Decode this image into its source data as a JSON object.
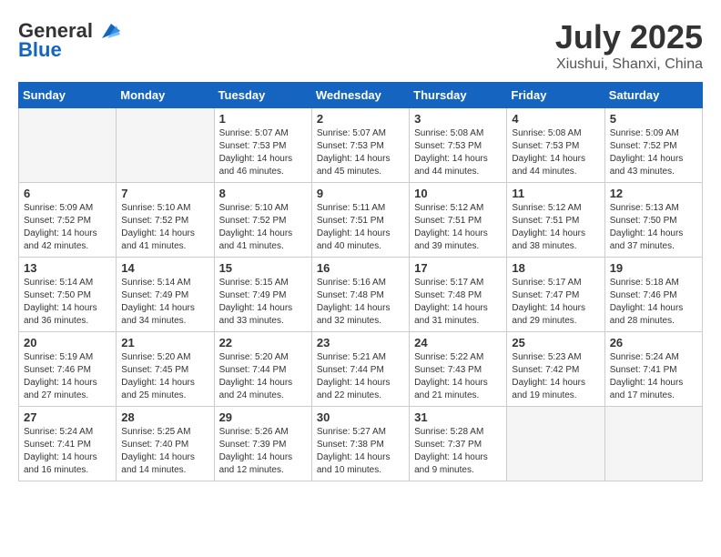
{
  "header": {
    "logo_general": "General",
    "logo_blue": "Blue",
    "title": "July 2025",
    "subtitle": "Xiushui, Shanxi, China"
  },
  "weekdays": [
    "Sunday",
    "Monday",
    "Tuesday",
    "Wednesday",
    "Thursday",
    "Friday",
    "Saturday"
  ],
  "weeks": [
    [
      {
        "day": "",
        "info": ""
      },
      {
        "day": "",
        "info": ""
      },
      {
        "day": "1",
        "info": "Sunrise: 5:07 AM\nSunset: 7:53 PM\nDaylight: 14 hours and 46 minutes."
      },
      {
        "day": "2",
        "info": "Sunrise: 5:07 AM\nSunset: 7:53 PM\nDaylight: 14 hours and 45 minutes."
      },
      {
        "day": "3",
        "info": "Sunrise: 5:08 AM\nSunset: 7:53 PM\nDaylight: 14 hours and 44 minutes."
      },
      {
        "day": "4",
        "info": "Sunrise: 5:08 AM\nSunset: 7:53 PM\nDaylight: 14 hours and 44 minutes."
      },
      {
        "day": "5",
        "info": "Sunrise: 5:09 AM\nSunset: 7:52 PM\nDaylight: 14 hours and 43 minutes."
      }
    ],
    [
      {
        "day": "6",
        "info": "Sunrise: 5:09 AM\nSunset: 7:52 PM\nDaylight: 14 hours and 42 minutes."
      },
      {
        "day": "7",
        "info": "Sunrise: 5:10 AM\nSunset: 7:52 PM\nDaylight: 14 hours and 41 minutes."
      },
      {
        "day": "8",
        "info": "Sunrise: 5:10 AM\nSunset: 7:52 PM\nDaylight: 14 hours and 41 minutes."
      },
      {
        "day": "9",
        "info": "Sunrise: 5:11 AM\nSunset: 7:51 PM\nDaylight: 14 hours and 40 minutes."
      },
      {
        "day": "10",
        "info": "Sunrise: 5:12 AM\nSunset: 7:51 PM\nDaylight: 14 hours and 39 minutes."
      },
      {
        "day": "11",
        "info": "Sunrise: 5:12 AM\nSunset: 7:51 PM\nDaylight: 14 hours and 38 minutes."
      },
      {
        "day": "12",
        "info": "Sunrise: 5:13 AM\nSunset: 7:50 PM\nDaylight: 14 hours and 37 minutes."
      }
    ],
    [
      {
        "day": "13",
        "info": "Sunrise: 5:14 AM\nSunset: 7:50 PM\nDaylight: 14 hours and 36 minutes."
      },
      {
        "day": "14",
        "info": "Sunrise: 5:14 AM\nSunset: 7:49 PM\nDaylight: 14 hours and 34 minutes."
      },
      {
        "day": "15",
        "info": "Sunrise: 5:15 AM\nSunset: 7:49 PM\nDaylight: 14 hours and 33 minutes."
      },
      {
        "day": "16",
        "info": "Sunrise: 5:16 AM\nSunset: 7:48 PM\nDaylight: 14 hours and 32 minutes."
      },
      {
        "day": "17",
        "info": "Sunrise: 5:17 AM\nSunset: 7:48 PM\nDaylight: 14 hours and 31 minutes."
      },
      {
        "day": "18",
        "info": "Sunrise: 5:17 AM\nSunset: 7:47 PM\nDaylight: 14 hours and 29 minutes."
      },
      {
        "day": "19",
        "info": "Sunrise: 5:18 AM\nSunset: 7:46 PM\nDaylight: 14 hours and 28 minutes."
      }
    ],
    [
      {
        "day": "20",
        "info": "Sunrise: 5:19 AM\nSunset: 7:46 PM\nDaylight: 14 hours and 27 minutes."
      },
      {
        "day": "21",
        "info": "Sunrise: 5:20 AM\nSunset: 7:45 PM\nDaylight: 14 hours and 25 minutes."
      },
      {
        "day": "22",
        "info": "Sunrise: 5:20 AM\nSunset: 7:44 PM\nDaylight: 14 hours and 24 minutes."
      },
      {
        "day": "23",
        "info": "Sunrise: 5:21 AM\nSunset: 7:44 PM\nDaylight: 14 hours and 22 minutes."
      },
      {
        "day": "24",
        "info": "Sunrise: 5:22 AM\nSunset: 7:43 PM\nDaylight: 14 hours and 21 minutes."
      },
      {
        "day": "25",
        "info": "Sunrise: 5:23 AM\nSunset: 7:42 PM\nDaylight: 14 hours and 19 minutes."
      },
      {
        "day": "26",
        "info": "Sunrise: 5:24 AM\nSunset: 7:41 PM\nDaylight: 14 hours and 17 minutes."
      }
    ],
    [
      {
        "day": "27",
        "info": "Sunrise: 5:24 AM\nSunset: 7:41 PM\nDaylight: 14 hours and 16 minutes."
      },
      {
        "day": "28",
        "info": "Sunrise: 5:25 AM\nSunset: 7:40 PM\nDaylight: 14 hours and 14 minutes."
      },
      {
        "day": "29",
        "info": "Sunrise: 5:26 AM\nSunset: 7:39 PM\nDaylight: 14 hours and 12 minutes."
      },
      {
        "day": "30",
        "info": "Sunrise: 5:27 AM\nSunset: 7:38 PM\nDaylight: 14 hours and 10 minutes."
      },
      {
        "day": "31",
        "info": "Sunrise: 5:28 AM\nSunset: 7:37 PM\nDaylight: 14 hours and 9 minutes."
      },
      {
        "day": "",
        "info": ""
      },
      {
        "day": "",
        "info": ""
      }
    ]
  ]
}
